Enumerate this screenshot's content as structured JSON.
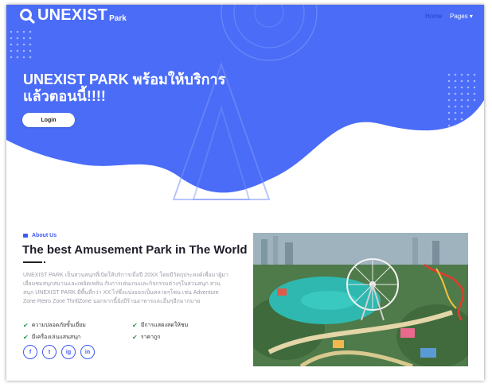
{
  "navbar": {
    "brand_name": "UNEXIST",
    "brand_sub": "Park",
    "home": "Home",
    "pages": "Pages ▾"
  },
  "hero": {
    "title_line1": "UNEXIST PARK พร้อมให้บริการ",
    "title_line2": "แล้วตอนนี้!!!!",
    "login_label": "Login"
  },
  "about": {
    "label": "About Us",
    "title": "The best Amusement Park in The World",
    "text": "UNEXIST PARK เป็นสวนสนุกที่เปิดให้บริการเมื่อปี 20XX โดยมีวัตถุประสงค์เพื่อมาผู้มาเยี่ยมชมสนุกสนานและเพลิดเพลิน กับการเล่นเกมและกิจกรรมต่างๆในสวนสนุก สวนสนุก UNEXIST PARK มีพื้นที่กว่า XX ไร่ซึ่งแบ่งออกเป็นหลายๆโซน เช่น Adventure Zone Retro Zone ThrillZone นอกจากนี้ยังมีร้านอาหารและอื่นๆอีกมากมาย",
    "features": [
      "ความปลอดภัยขั้นเยี่ยม",
      "มีการแสดงสดให้ชม",
      "มีเครื่องเล่นแสนสนุก",
      "ราคาถูก"
    ],
    "socials": [
      "f",
      "t",
      "ig",
      "in"
    ]
  },
  "colors": {
    "primary": "#4a6cf7",
    "accent_text": "#3d5af1",
    "check": "#1e9d4b"
  }
}
